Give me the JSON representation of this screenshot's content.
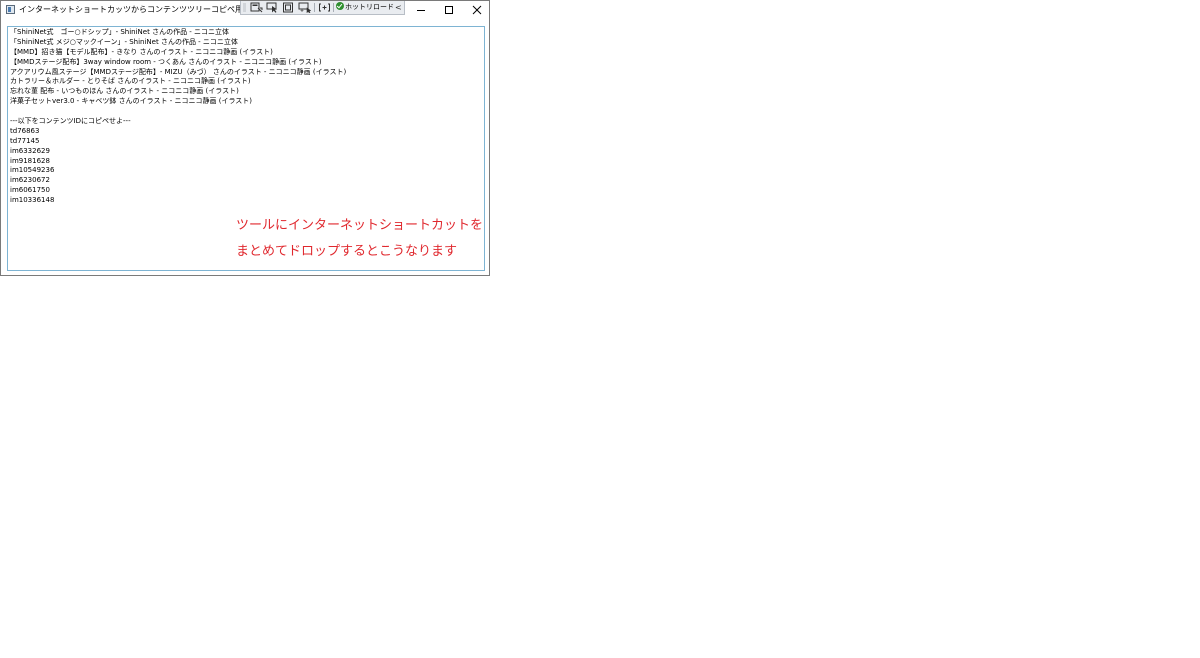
{
  "window": {
    "title": "インターネットショートカッツからコンテンツツリーコピペ用テキストを作るツール"
  },
  "dev_toolbar": {
    "hot_reload_label": "ホットリロード",
    "collapse_glyph": "<"
  },
  "window_controls": {
    "minimize": "minimize-icon",
    "maximize": "maximize-icon",
    "close": "close-icon"
  },
  "text_content": {
    "lines": [
      "「ShiniNet式　ゴー○ドシップ」- ShiniNet さんの作品 - ニコニ立体",
      "「ShiniNet式 メジ○マックイーン」- ShiniNet さんの作品 - ニコニ立体",
      "【MMD】招き猫【モデル配布】- きなり さんのイラスト - ニコニコ静画 (イラスト)",
      "【MMDステージ配布】3way window room - つくあん さんのイラスト - ニコニコ静画 (イラスト)",
      "アクアリウム風ステージ【MMDステージ配布】- MIZU（みづ） さんのイラスト - ニコニコ静画 (イラスト)",
      "カトラリー＆ホルダー - とりそば さんのイラスト - ニコニコ静画 (イラスト)",
      "忘れな菫 配布 - いつものほん さんのイラスト - ニコニコ静画 (イラスト)",
      "洋菓子セットver3.0 - キャベツ鉢 さんのイラスト - ニコニコ静画 (イラスト)",
      "",
      "---以下をコンテンツIDにコピペせよ---",
      "td76863",
      "td77145",
      "im6332629",
      "im9181628",
      "im10549236",
      "im6230672",
      "im6061750",
      "im10336148"
    ]
  },
  "annotation": {
    "line1": "ツールにインターネットショートカットを",
    "line2": "まとめてドロップするとこうなります",
    "color": "#e0282e"
  },
  "colors": {
    "textbox_border": "#7eb4d3",
    "window_border": "#7a7a7a"
  }
}
